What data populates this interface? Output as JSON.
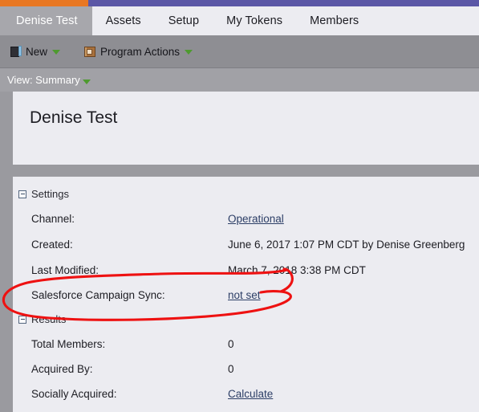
{
  "accent": {
    "orange": "#e87722",
    "purple": "#5b57a6"
  },
  "tabs": [
    {
      "label": "Denise Test",
      "active": true
    },
    {
      "label": "Assets",
      "active": false
    },
    {
      "label": "Setup",
      "active": false
    },
    {
      "label": "My Tokens",
      "active": false
    },
    {
      "label": "Members",
      "active": false
    }
  ],
  "toolbar": {
    "new_label": "New",
    "new_icon": "program-cube-icon",
    "program_actions_label": "Program Actions",
    "program_actions_icon": "book-icon",
    "caret_icon": "caret-down-icon"
  },
  "viewbar": {
    "label": "View: Summary",
    "caret_icon": "caret-down-icon"
  },
  "page": {
    "title": "Denise Test"
  },
  "sections": [
    {
      "name": "settings",
      "label": "Settings",
      "toggle_icon": "collapse-minus-icon",
      "rows": [
        {
          "label": "Channel:",
          "value": "Operational",
          "link": true
        },
        {
          "label": "Created:",
          "value": "June 6, 2017 1:07 PM CDT by Denise Greenberg",
          "link": false
        },
        {
          "label": "Last Modified:",
          "value": "March 7, 2018 3:38 PM CDT",
          "link": false
        },
        {
          "label": "Salesforce Campaign Sync:",
          "value": "not set",
          "link": true
        }
      ]
    },
    {
      "name": "results",
      "label": "Results",
      "toggle_icon": "collapse-minus-icon",
      "rows": [
        {
          "label": "Total Members:",
          "value": "0",
          "link": false
        },
        {
          "label": "Acquired By:",
          "value": "0",
          "link": false
        },
        {
          "label": "Socially Acquired:",
          "value": "Calculate",
          "link": true
        }
      ]
    }
  ],
  "annotation": {
    "name": "red-ellipse-highlight",
    "color": "#ee1111",
    "encircles": "Salesforce Campaign Sync: not set"
  }
}
